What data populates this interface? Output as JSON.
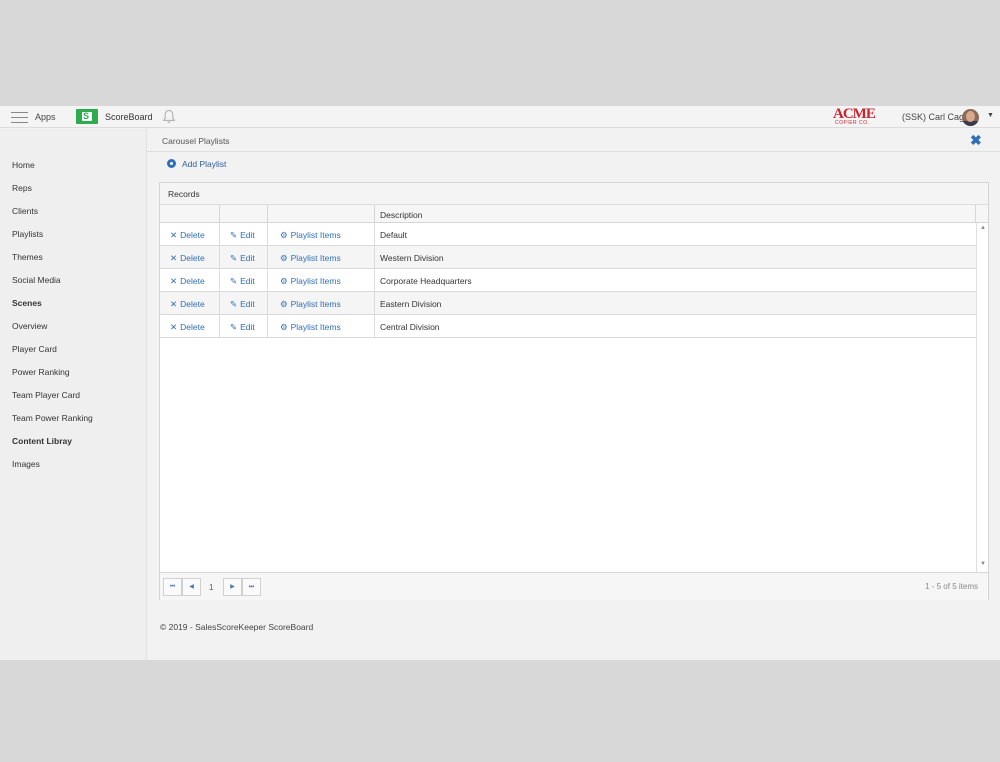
{
  "topbar": {
    "apps_label": "Apps",
    "brand_label": "ScoreBoard",
    "company_logo_text": "ACME",
    "company_logo_sub": "COPIER CO.",
    "user_label": "(SSK) Carl Cage"
  },
  "sidebar": {
    "items": [
      {
        "label": "Home"
      },
      {
        "label": "Reps"
      },
      {
        "label": "Clients"
      },
      {
        "label": "Playlists"
      },
      {
        "label": "Themes"
      },
      {
        "label": "Social Media"
      }
    ],
    "scenes_header": "Scenes",
    "scenes": [
      {
        "label": "Overview"
      },
      {
        "label": "Player Card"
      },
      {
        "label": "Power Ranking"
      },
      {
        "label": "Team Player Card"
      },
      {
        "label": "Team Power Ranking"
      }
    ],
    "content_header": "Content Libray",
    "content": [
      {
        "label": "Images"
      }
    ]
  },
  "main": {
    "breadcrumb": "Carousel Playlists",
    "add_button": "Add Playlist",
    "panel_title": "Records",
    "columns": [
      "",
      "",
      "",
      "Description"
    ],
    "actions": {
      "delete": "Delete",
      "edit": "Edit",
      "items": "Playlist Items"
    },
    "rows": [
      {
        "description": "Default"
      },
      {
        "description": "Western Division"
      },
      {
        "description": "Corporate Headquarters"
      },
      {
        "description": "Eastern Division"
      },
      {
        "description": "Central Division"
      }
    ],
    "pager": {
      "page": "1",
      "info": "1 - 5 of 5 items"
    }
  },
  "footer": "© 2019 - SalesScoreKeeper ScoreBoard",
  "colors": {
    "accent": "#2f6fb8",
    "brand_green": "#2eaa4f",
    "acme_red": "#c8262d"
  }
}
